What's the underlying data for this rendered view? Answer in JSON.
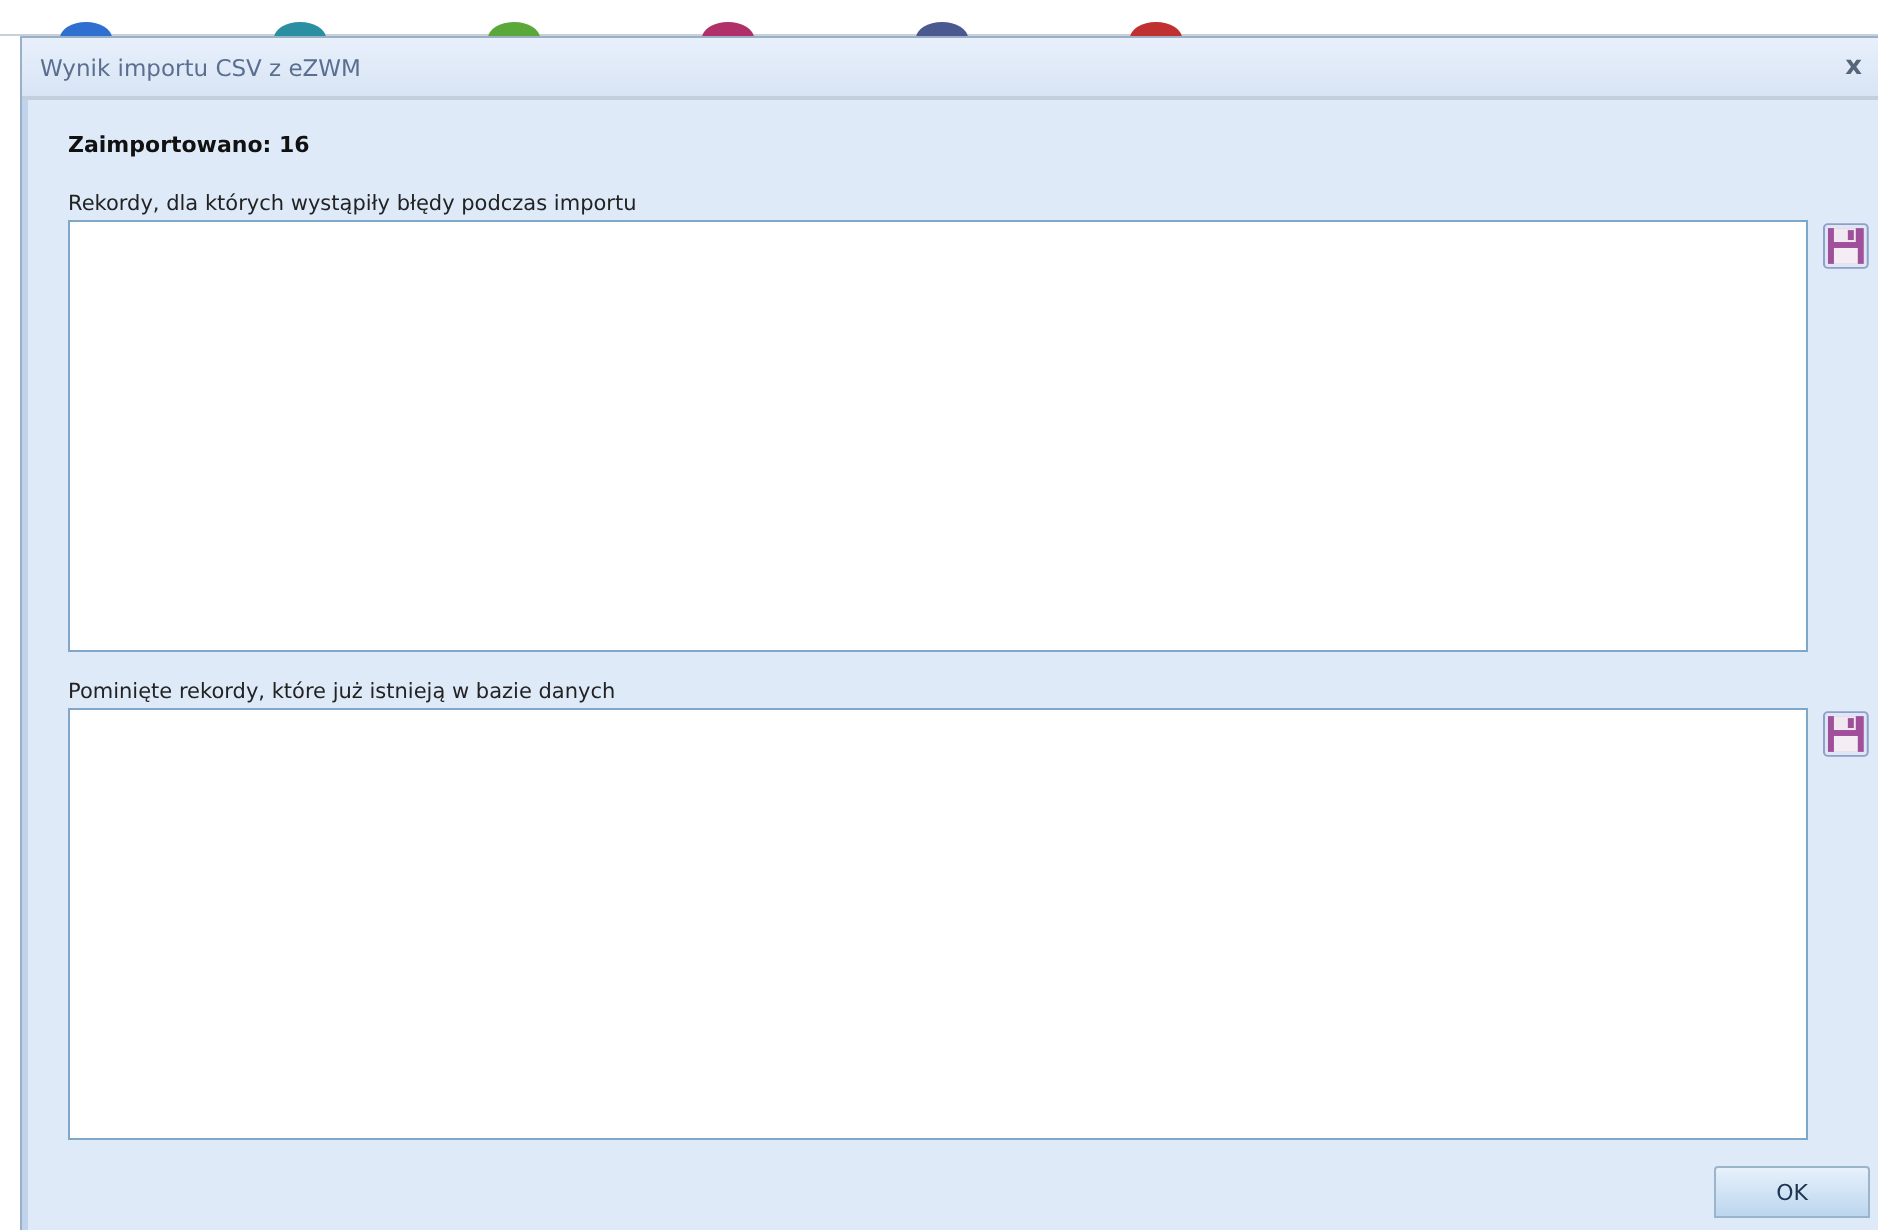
{
  "window": {
    "title": "Wynik importu CSV z eZWM",
    "close": "x"
  },
  "summary": "Zaimportowano: 16",
  "sections": [
    {
      "label": "Rekordy, dla których wystąpiły błędy podczas importu"
    },
    {
      "label": "Pominięte rekordy, które już istnieją w bazie danych"
    }
  ],
  "buttons": [
    "OK"
  ]
}
